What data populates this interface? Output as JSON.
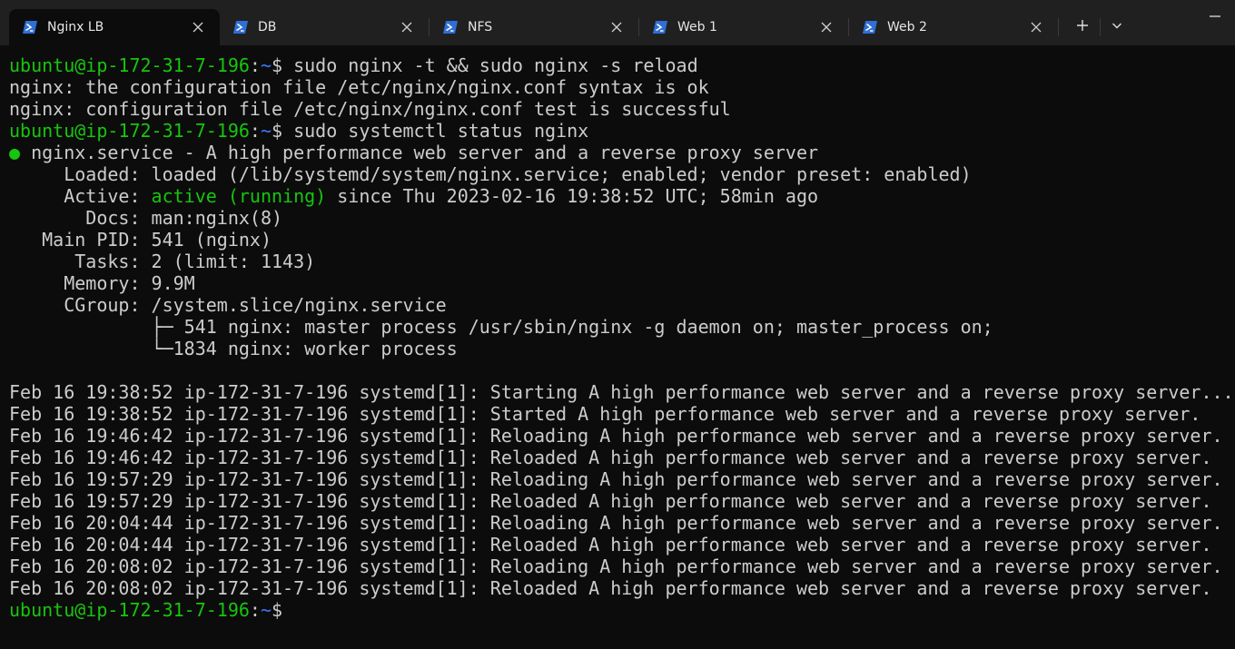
{
  "tabs": [
    {
      "label": "Nginx LB",
      "active": true
    },
    {
      "label": "DB",
      "active": false
    },
    {
      "label": "NFS",
      "active": false
    },
    {
      "label": "Web 1",
      "active": false
    },
    {
      "label": "Web 2",
      "active": false
    }
  ],
  "icons": {
    "tab_icon": "powershell-icon",
    "close": "close-icon",
    "new_tab": "plus-icon",
    "dropdown": "chevron-down-icon",
    "minimize": "minimize-icon"
  },
  "colors": {
    "background": "#0c0c0c",
    "titlebar": "#202020",
    "prompt_user": "#16c60c",
    "prompt_path": "#3b78ff",
    "text": "#cccccc"
  },
  "terminal": {
    "prompt_user": "ubuntu@ip-172-31-7-196",
    "prompt_colon": ":",
    "prompt_path": "~",
    "prompt_dollar": "$",
    "cmd1": " sudo nginx -t && sudo nginx -s reload",
    "out1": "nginx: the configuration file /etc/nginx/nginx.conf syntax is ok",
    "out2": "nginx: configuration file /etc/nginx/nginx.conf test is successful",
    "cmd2": " sudo systemctl status nginx",
    "status_dot": "●",
    "status_title": " nginx.service - A high performance web server and a reverse proxy server",
    "loaded": "     Loaded: loaded (/lib/systemd/system/nginx.service; enabled; vendor preset: enabled)",
    "active_label": "     Active: ",
    "active_state": "active (running)",
    "active_since": " since Thu 2023-02-16 19:38:52 UTC; 58min ago",
    "docs": "       Docs: man:nginx(8)",
    "main_pid": "   Main PID: 541 (nginx)",
    "tasks": "      Tasks: 2 (limit: 1143)",
    "memory": "     Memory: 9.9M",
    "cgroup": "     CGroup: /system.slice/nginx.service",
    "cgroup_child1": "             ├─ 541 nginx: master process /usr/sbin/nginx -g daemon on; master_process on;",
    "cgroup_child2": "             └─1834 nginx: worker process",
    "log": [
      "Feb 16 19:38:52 ip-172-31-7-196 systemd[1]: Starting A high performance web server and a reverse proxy server...",
      "Feb 16 19:38:52 ip-172-31-7-196 systemd[1]: Started A high performance web server and a reverse proxy server.",
      "Feb 16 19:46:42 ip-172-31-7-196 systemd[1]: Reloading A high performance web server and a reverse proxy server.",
      "Feb 16 19:46:42 ip-172-31-7-196 systemd[1]: Reloaded A high performance web server and a reverse proxy server.",
      "Feb 16 19:57:29 ip-172-31-7-196 systemd[1]: Reloading A high performance web server and a reverse proxy server.",
      "Feb 16 19:57:29 ip-172-31-7-196 systemd[1]: Reloaded A high performance web server and a reverse proxy server.",
      "Feb 16 20:04:44 ip-172-31-7-196 systemd[1]: Reloading A high performance web server and a reverse proxy server.",
      "Feb 16 20:04:44 ip-172-31-7-196 systemd[1]: Reloaded A high performance web server and a reverse proxy server.",
      "Feb 16 20:08:02 ip-172-31-7-196 systemd[1]: Reloading A high performance web server and a reverse proxy server.",
      "Feb 16 20:08:02 ip-172-31-7-196 systemd[1]: Reloaded A high performance web server and a reverse proxy server."
    ]
  }
}
